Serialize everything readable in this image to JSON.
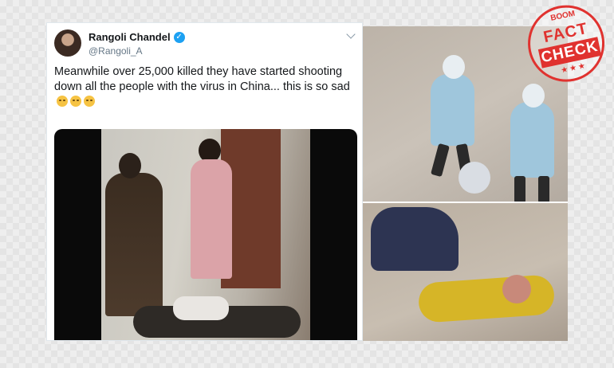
{
  "tweet": {
    "display_name": "Rangoli Chandel",
    "handle": "@Rangoli_A",
    "text": "Meanwhile over 25,000 killed they have started shooting down all the people with the virus in China... this is so sad",
    "emoji_count": 3,
    "verified": true
  },
  "stamp": {
    "brand": "BOOM",
    "line1": "FACT",
    "line2": "CHECK",
    "stars": "★★★",
    "color": "#e0322f"
  },
  "icons": {
    "verified": "verified-badge-icon",
    "menu": "chevron-down-icon"
  }
}
